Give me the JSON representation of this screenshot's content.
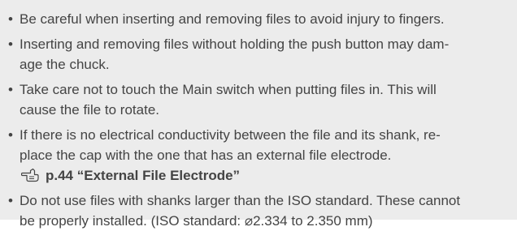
{
  "notes": {
    "bullet_symbol": "•",
    "items": [
      {
        "lines": [
          "Be careful when inserting and removing files to avoid injury to fingers."
        ]
      },
      {
        "lines": [
          "Inserting and removing files without holding the push button may dam-",
          "age the chuck."
        ]
      },
      {
        "lines": [
          "Take care not to touch the Main switch when putting files in. This will",
          "cause the file to rotate."
        ]
      },
      {
        "lines": [
          "If there is no electrical conductivity between the file and its shank, re-",
          "place the cap with the one that has an external file electrode."
        ],
        "reference": {
          "icon": "pointing-hand-reference-icon",
          "page": "p.44",
          "title": "“External File Electrode”"
        }
      },
      {
        "lines": [
          "Do not use files with shanks larger than the ISO standard. These cannot",
          "be properly installed. (ISO standard: ⌀2.334 to 2.350 mm)"
        ]
      }
    ]
  },
  "colors": {
    "background": "#ececec",
    "text": "#444444"
  }
}
